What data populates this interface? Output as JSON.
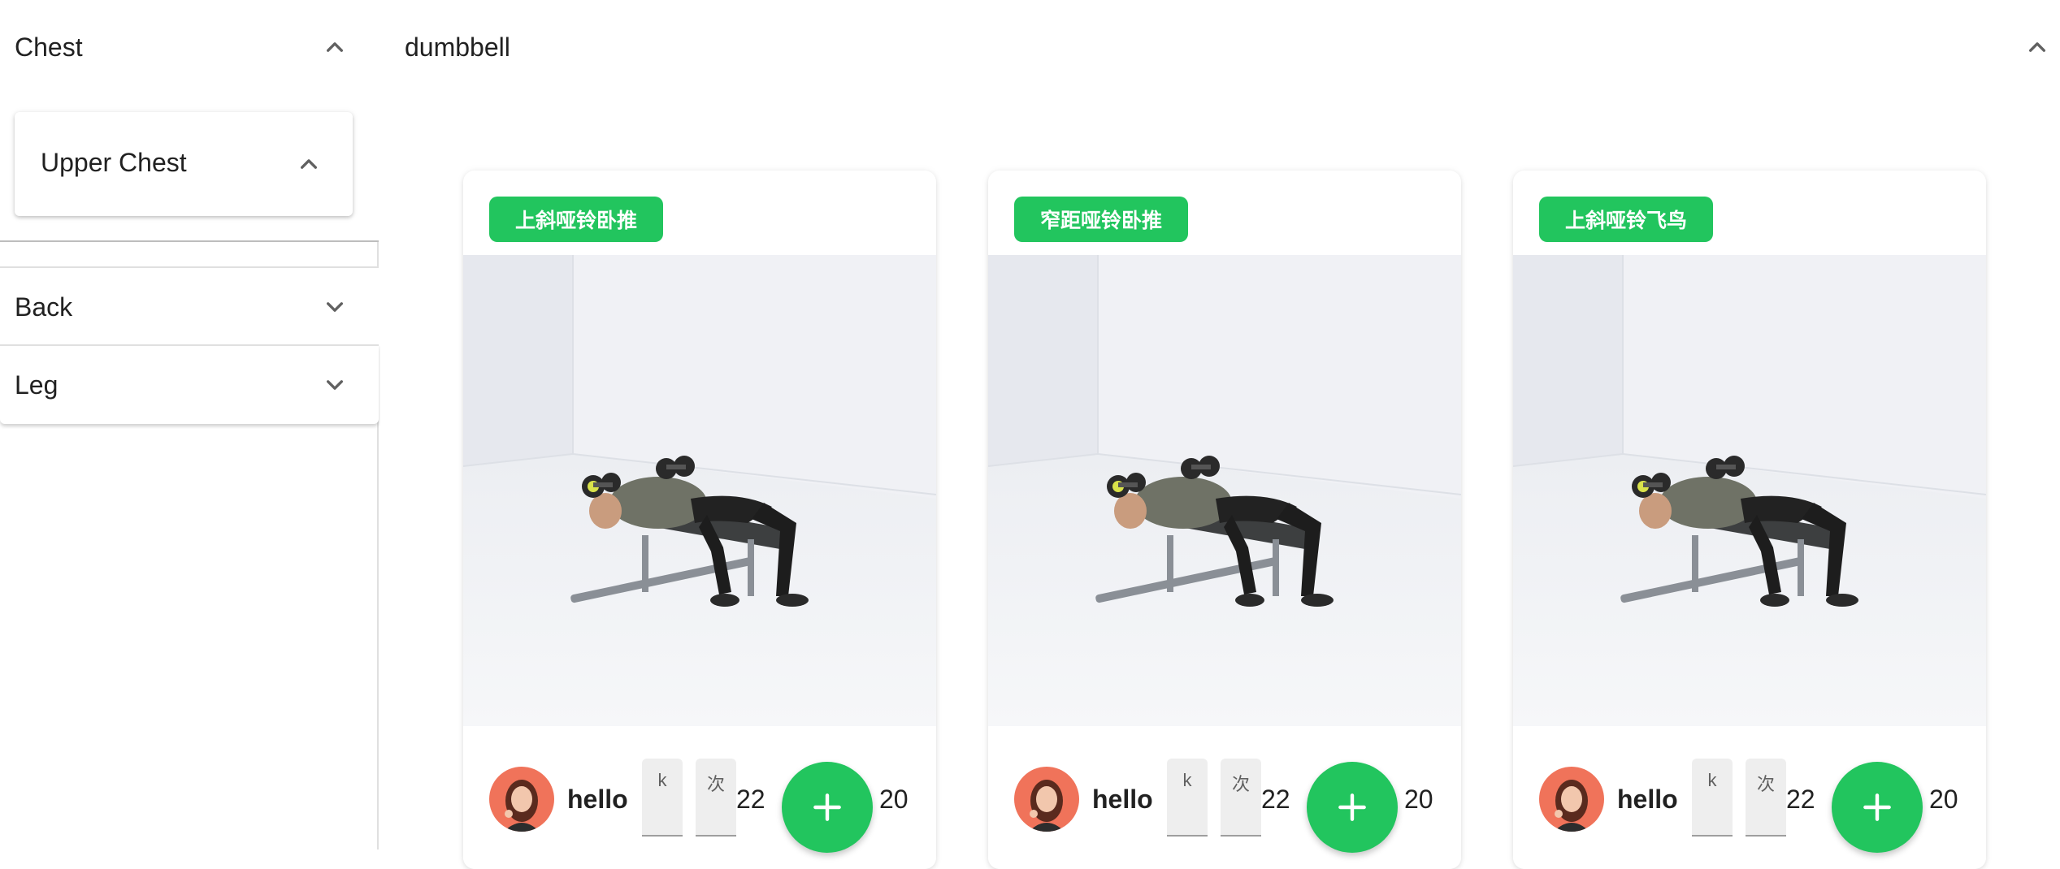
{
  "sidebar": {
    "chest": {
      "label": "Chest",
      "expanded": true,
      "icon": "chevron-up-icon"
    },
    "upper_chest": {
      "label": "Upper Chest",
      "expanded": true,
      "icon": "chevron-up-icon"
    },
    "back": {
      "label": "Back",
      "expanded": false,
      "icon": "chevron-down-icon"
    },
    "leg": {
      "label": "Leg",
      "expanded": false,
      "icon": "chevron-down-icon"
    }
  },
  "main": {
    "title": "dumbbell",
    "collapse_icon": "chevron-up-icon",
    "accent_color": "#22c55e",
    "cards": [
      {
        "badge": "上斜哑铃卧推",
        "username": "hello",
        "input1_placeholder": "k",
        "input2_placeholder": "次",
        "value_a": "22",
        "add_icon": "plus-icon",
        "value_b": "20"
      },
      {
        "badge": "窄距哑铃卧推",
        "username": "hello",
        "input1_placeholder": "k",
        "input2_placeholder": "次",
        "value_a": "22",
        "add_icon": "plus-icon",
        "value_b": "20"
      },
      {
        "badge": "上斜哑铃飞鸟",
        "username": "hello",
        "input1_placeholder": "k",
        "input2_placeholder": "次",
        "value_a": "22",
        "add_icon": "plus-icon",
        "value_b": "20"
      }
    ]
  }
}
